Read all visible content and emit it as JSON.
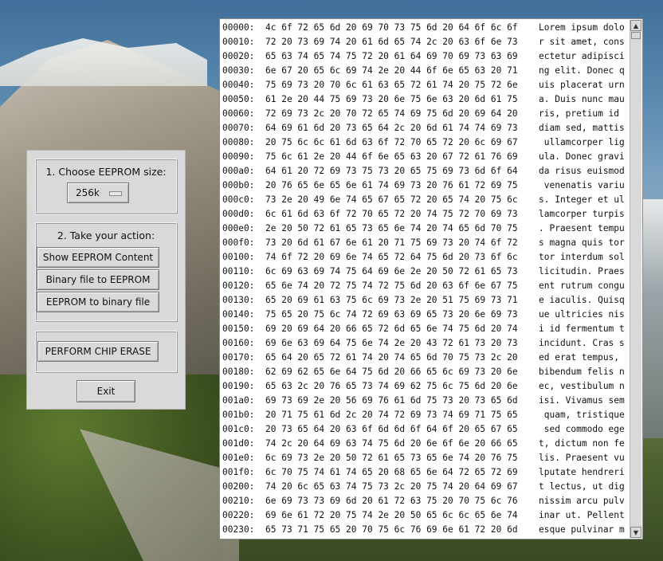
{
  "control_panel": {
    "choose_label": "1. Choose EEPROM size:",
    "size_selected": "256k",
    "action_label": "2. Take your action:",
    "show_button": "Show EEPROM Content",
    "bin_to_eeprom_button": "Binary file to EEPROM",
    "eeprom_to_bin_button": "EEPROM to binary file",
    "erase_button": "PERFORM CHIP ERASE",
    "exit_button": "Exit"
  },
  "hexdump": {
    "rows": [
      {
        "offset": "00000:",
        "hex": "4c 6f 72 65 6d 20 69 70 73 75 6d 20 64 6f 6c 6f",
        "ascii": "Lorem ipsum dolo"
      },
      {
        "offset": "00010:",
        "hex": "72 20 73 69 74 20 61 6d 65 74 2c 20 63 6f 6e 73",
        "ascii": "r sit amet, cons"
      },
      {
        "offset": "00020:",
        "hex": "65 63 74 65 74 75 72 20 61 64 69 70 69 73 63 69",
        "ascii": "ectetur adipisci"
      },
      {
        "offset": "00030:",
        "hex": "6e 67 20 65 6c 69 74 2e 20 44 6f 6e 65 63 20 71",
        "ascii": "ng elit. Donec q"
      },
      {
        "offset": "00040:",
        "hex": "75 69 73 20 70 6c 61 63 65 72 61 74 20 75 72 6e",
        "ascii": "uis placerat urn"
      },
      {
        "offset": "00050:",
        "hex": "61 2e 20 44 75 69 73 20 6e 75 6e 63 20 6d 61 75",
        "ascii": "a. Duis nunc mau"
      },
      {
        "offset": "00060:",
        "hex": "72 69 73 2c 20 70 72 65 74 69 75 6d 20 69 64 20",
        "ascii": "ris, pretium id "
      },
      {
        "offset": "00070:",
        "hex": "64 69 61 6d 20 73 65 64 2c 20 6d 61 74 74 69 73",
        "ascii": "diam sed, mattis"
      },
      {
        "offset": "00080:",
        "hex": "20 75 6c 6c 61 6d 63 6f 72 70 65 72 20 6c 69 67",
        "ascii": " ullamcorper lig"
      },
      {
        "offset": "00090:",
        "hex": "75 6c 61 2e 20 44 6f 6e 65 63 20 67 72 61 76 69",
        "ascii": "ula. Donec gravi"
      },
      {
        "offset": "000a0:",
        "hex": "64 61 20 72 69 73 75 73 20 65 75 69 73 6d 6f 64",
        "ascii": "da risus euismod"
      },
      {
        "offset": "000b0:",
        "hex": "20 76 65 6e 65 6e 61 74 69 73 20 76 61 72 69 75",
        "ascii": " venenatis variu"
      },
      {
        "offset": "000c0:",
        "hex": "73 2e 20 49 6e 74 65 67 65 72 20 65 74 20 75 6c",
        "ascii": "s. Integer et ul"
      },
      {
        "offset": "000d0:",
        "hex": "6c 61 6d 63 6f 72 70 65 72 20 74 75 72 70 69 73",
        "ascii": "lamcorper turpis"
      },
      {
        "offset": "000e0:",
        "hex": "2e 20 50 72 61 65 73 65 6e 74 20 74 65 6d 70 75",
        "ascii": ". Praesent tempu"
      },
      {
        "offset": "000f0:",
        "hex": "73 20 6d 61 67 6e 61 20 71 75 69 73 20 74 6f 72",
        "ascii": "s magna quis tor"
      },
      {
        "offset": "00100:",
        "hex": "74 6f 72 20 69 6e 74 65 72 64 75 6d 20 73 6f 6c",
        "ascii": "tor interdum sol"
      },
      {
        "offset": "00110:",
        "hex": "6c 69 63 69 74 75 64 69 6e 2e 20 50 72 61 65 73",
        "ascii": "licitudin. Praes"
      },
      {
        "offset": "00120:",
        "hex": "65 6e 74 20 72 75 74 72 75 6d 20 63 6f 6e 67 75",
        "ascii": "ent rutrum congu"
      },
      {
        "offset": "00130:",
        "hex": "65 20 69 61 63 75 6c 69 73 2e 20 51 75 69 73 71",
        "ascii": "e iaculis. Quisq"
      },
      {
        "offset": "00140:",
        "hex": "75 65 20 75 6c 74 72 69 63 69 65 73 20 6e 69 73",
        "ascii": "ue ultricies nis"
      },
      {
        "offset": "00150:",
        "hex": "69 20 69 64 20 66 65 72 6d 65 6e 74 75 6d 20 74",
        "ascii": "i id fermentum t"
      },
      {
        "offset": "00160:",
        "hex": "69 6e 63 69 64 75 6e 74 2e 20 43 72 61 73 20 73",
        "ascii": "incidunt. Cras s"
      },
      {
        "offset": "00170:",
        "hex": "65 64 20 65 72 61 74 20 74 65 6d 70 75 73 2c 20",
        "ascii": "ed erat tempus, "
      },
      {
        "offset": "00180:",
        "hex": "62 69 62 65 6e 64 75 6d 20 66 65 6c 69 73 20 6e",
        "ascii": "bibendum felis n"
      },
      {
        "offset": "00190:",
        "hex": "65 63 2c 20 76 65 73 74 69 62 75 6c 75 6d 20 6e",
        "ascii": "ec, vestibulum n"
      },
      {
        "offset": "001a0:",
        "hex": "69 73 69 2e 20 56 69 76 61 6d 75 73 20 73 65 6d",
        "ascii": "isi. Vivamus sem"
      },
      {
        "offset": "001b0:",
        "hex": "20 71 75 61 6d 2c 20 74 72 69 73 74 69 71 75 65",
        "ascii": " quam, tristique"
      },
      {
        "offset": "001c0:",
        "hex": "20 73 65 64 20 63 6f 6d 6d 6f 64 6f 20 65 67 65",
        "ascii": " sed commodo ege"
      },
      {
        "offset": "001d0:",
        "hex": "74 2c 20 64 69 63 74 75 6d 20 6e 6f 6e 20 66 65",
        "ascii": "t, dictum non fe"
      },
      {
        "offset": "001e0:",
        "hex": "6c 69 73 2e 20 50 72 61 65 73 65 6e 74 20 76 75",
        "ascii": "lis. Praesent vu"
      },
      {
        "offset": "001f0:",
        "hex": "6c 70 75 74 61 74 65 20 68 65 6e 64 72 65 72 69",
        "ascii": "lputate hendreri"
      },
      {
        "offset": "00200:",
        "hex": "74 20 6c 65 63 74 75 73 2c 20 75 74 20 64 69 67",
        "ascii": "t lectus, ut dig"
      },
      {
        "offset": "00210:",
        "hex": "6e 69 73 73 69 6d 20 61 72 63 75 20 70 75 6c 76",
        "ascii": "nissim arcu pulv"
      },
      {
        "offset": "00220:",
        "hex": "69 6e 61 72 20 75 74 2e 20 50 65 6c 6c 65 6e 74",
        "ascii": "inar ut. Pellent"
      },
      {
        "offset": "00230:",
        "hex": "65 73 71 75 65 20 70 75 6c 76 69 6e 61 72 20 6d",
        "ascii": "esque pulvinar m"
      }
    ]
  },
  "icons": {
    "scroll_up": "▲",
    "scroll_down": "▼"
  }
}
